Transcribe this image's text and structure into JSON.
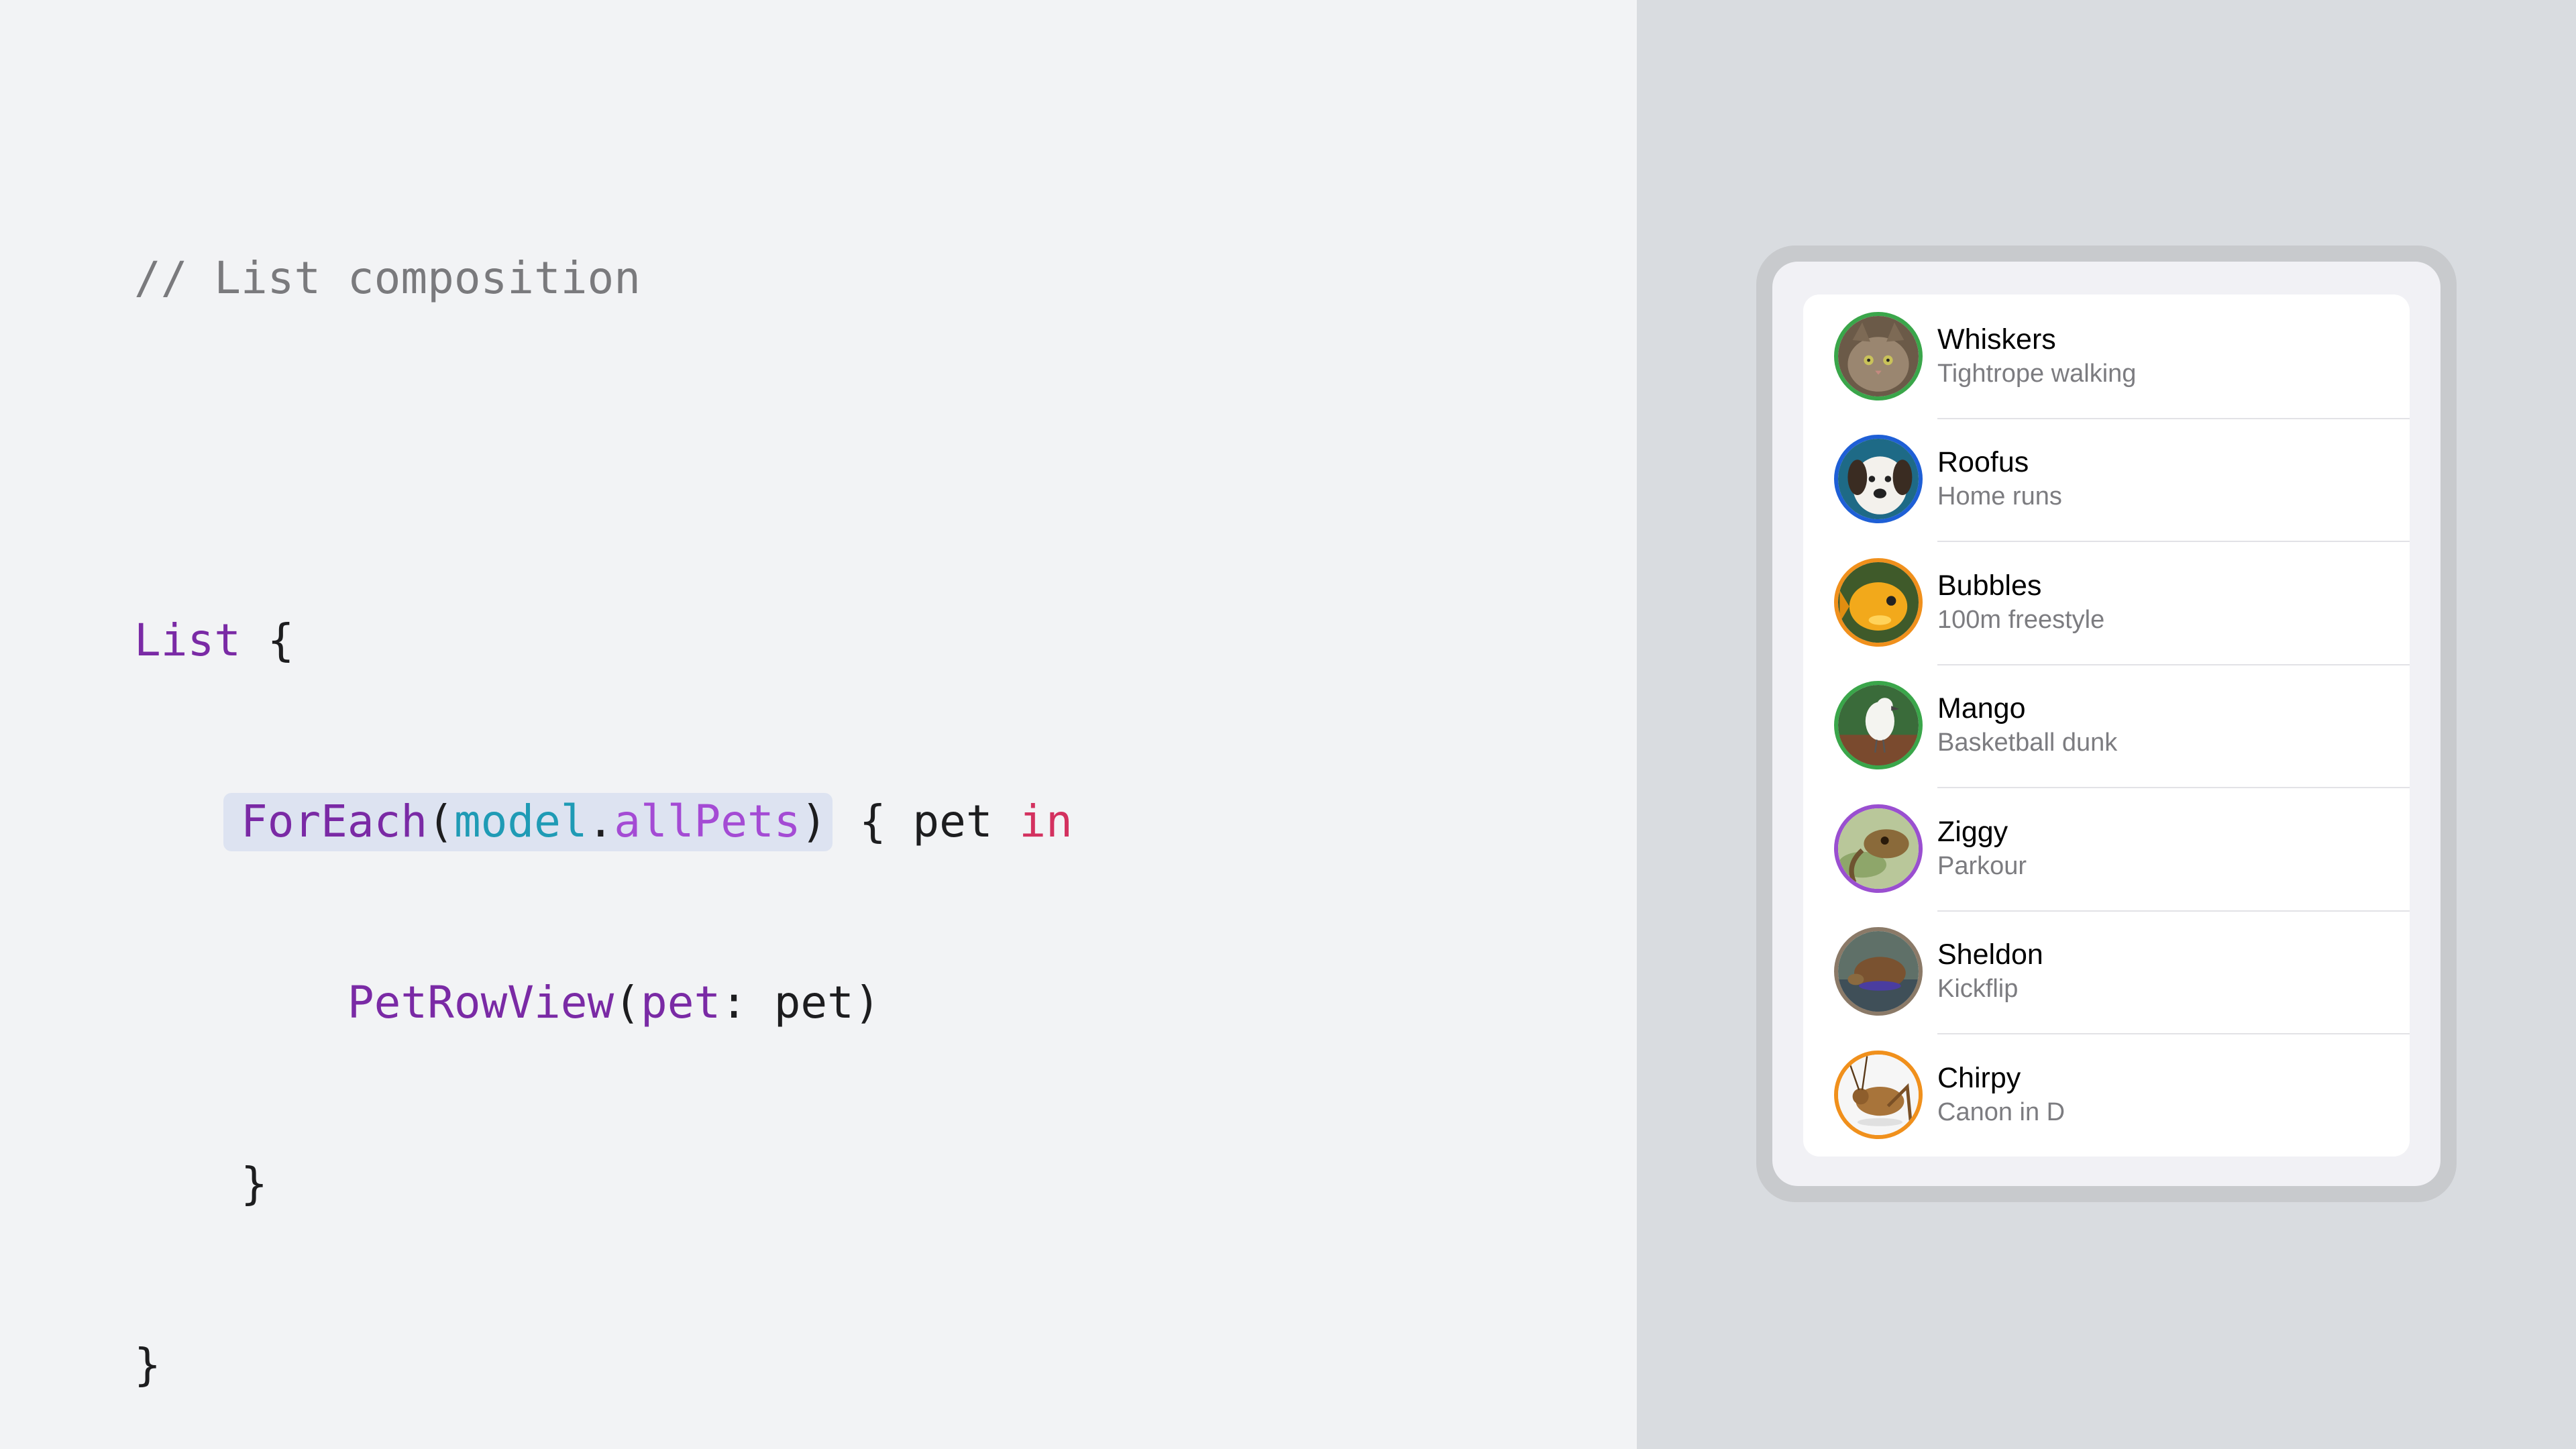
{
  "code": {
    "comment": "// List composition",
    "list_kw": "List",
    "open_brace": " {",
    "foreach": "ForEach",
    "paren_open": "(",
    "model": "model",
    "dot": ".",
    "allpets": "allPets",
    "paren_close": ")",
    "closure_head": " { pet ",
    "in_kw": "in",
    "rowview": "PetRowView",
    "rowview_paren": "(",
    "arg_label": "pet",
    "arg_rest": ": pet)",
    "inner_close": "}",
    "outer_close": "}"
  },
  "pets": [
    {
      "name": "Whiskers",
      "trick": "Tightrope walking",
      "ring_color": "#3aa64a",
      "icon": "cat-photo-icon"
    },
    {
      "name": "Roofus",
      "trick": "Home runs",
      "ring_color": "#1e5fd6",
      "icon": "dog-photo-icon"
    },
    {
      "name": "Bubbles",
      "trick": "100m freestyle",
      "ring_color": "#f0901c",
      "icon": "fish-photo-icon"
    },
    {
      "name": "Mango",
      "trick": "Basketball dunk",
      "ring_color": "#3aa64a",
      "icon": "bird-photo-icon"
    },
    {
      "name": "Ziggy",
      "trick": "Parkour",
      "ring_color": "#9a4fd0",
      "icon": "lizard-photo-icon"
    },
    {
      "name": "Sheldon",
      "trick": "Kickflip",
      "ring_color": "#8b7a68",
      "icon": "turtle-photo-icon"
    },
    {
      "name": "Chirpy",
      "trick": "Canon in D",
      "ring_color": "#f0901c",
      "icon": "cricket-photo-icon"
    }
  ]
}
